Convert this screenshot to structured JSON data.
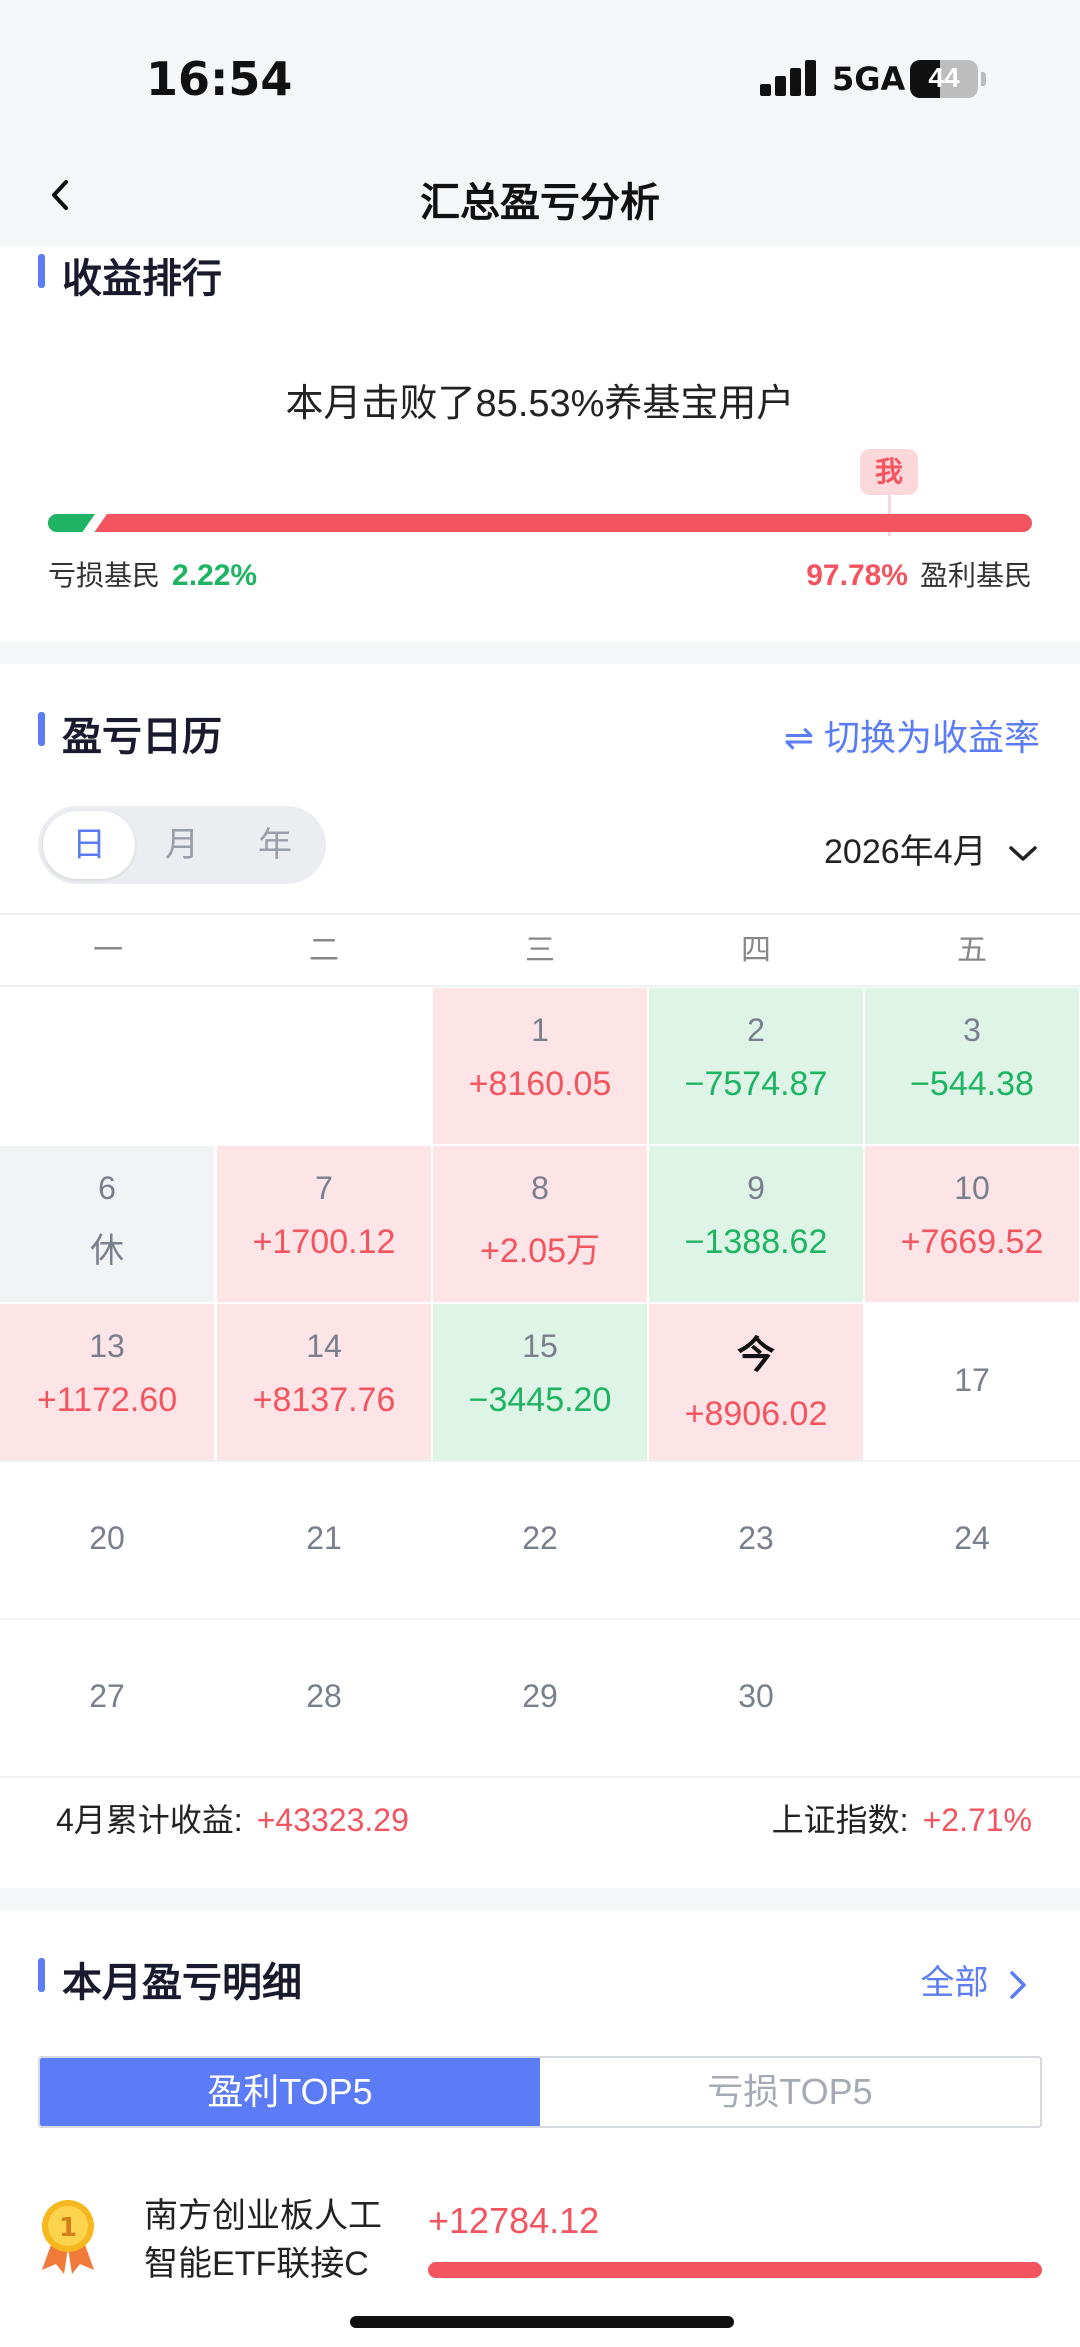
{
  "status_bar": {
    "time": "16:54",
    "network": "5GA",
    "battery": "44"
  },
  "nav": {
    "title": "汇总盈亏分析"
  },
  "ranking": {
    "title": "收益排行",
    "headline": "本月击败了85.53%养基宝用户",
    "me_label": "我",
    "loss_label": "亏损基民",
    "loss_pct": "2.22%",
    "gain_pct": "97.78%",
    "gain_label": "盈利基民",
    "position_fraction": 0.8553
  },
  "calendar": {
    "title": "盈亏日历",
    "switch_label": "⇌ 切换为收益率",
    "seg": [
      "日",
      "月",
      "年"
    ],
    "month": "2026年4月",
    "weekdays": [
      "一",
      "二",
      "三",
      "四",
      "五"
    ],
    "cells": [
      {
        "d": "1",
        "v": "+8160.05"
      },
      {
        "d": "2",
        "v": "−7574.87"
      },
      {
        "d": "3",
        "v": "−544.38"
      },
      {
        "d": "6",
        "v": "休"
      },
      {
        "d": "7",
        "v": "+1700.12"
      },
      {
        "d": "8",
        "v": "+2.05万"
      },
      {
        "d": "9",
        "v": "−1388.62"
      },
      {
        "d": "10",
        "v": "+7669.52"
      },
      {
        "d": "13",
        "v": "+1172.60"
      },
      {
        "d": "14",
        "v": "+8137.76"
      },
      {
        "d": "15",
        "v": "−3445.20"
      },
      {
        "d": "今",
        "v": "+8906.02"
      },
      {
        "d": "17",
        "v": ""
      },
      {
        "d": "20",
        "v": ""
      },
      {
        "d": "21",
        "v": ""
      },
      {
        "d": "22",
        "v": ""
      },
      {
        "d": "23",
        "v": ""
      },
      {
        "d": "24",
        "v": ""
      },
      {
        "d": "27",
        "v": ""
      },
      {
        "d": "28",
        "v": ""
      },
      {
        "d": "29",
        "v": ""
      },
      {
        "d": "30",
        "v": ""
      }
    ],
    "sum_label": "4月累计收益:",
    "sum_value": "+43323.29",
    "index_label": "上证指数:",
    "index_value": "+2.71%",
    "colors": {
      "gain": "#f2555f",
      "loss": "#1eb463",
      "accent": "#5b7cf6"
    }
  },
  "detail": {
    "title": "本月盈亏明细",
    "all_label": "全部",
    "tab_gain": "盈利TOP5",
    "tab_loss": "亏损TOP5",
    "medal_rank": "1",
    "fund_name": "南方创业板人工智能ETF联接C",
    "fund_value": "+12784.12"
  }
}
